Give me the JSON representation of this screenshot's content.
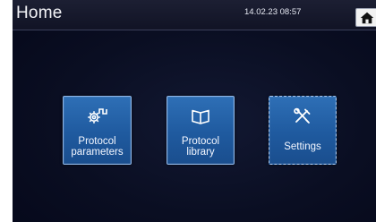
{
  "header": {
    "title": "Home",
    "datetime": "14.02.23 08:57",
    "home_icon": "home-icon"
  },
  "tiles": [
    {
      "id": "protocol-parameters",
      "line1": "Protocol",
      "line2": "parameters",
      "icon": "gear-wave-icon"
    },
    {
      "id": "protocol-library",
      "line1": "Protocol",
      "line2": "library",
      "icon": "open-book-icon"
    },
    {
      "id": "settings",
      "line1": "Settings",
      "icon": "tools-icon"
    }
  ],
  "colors": {
    "tile_fill": "#2565ac",
    "tile_border": "#8fb6e6",
    "screen_bg": "#0a0e22"
  }
}
